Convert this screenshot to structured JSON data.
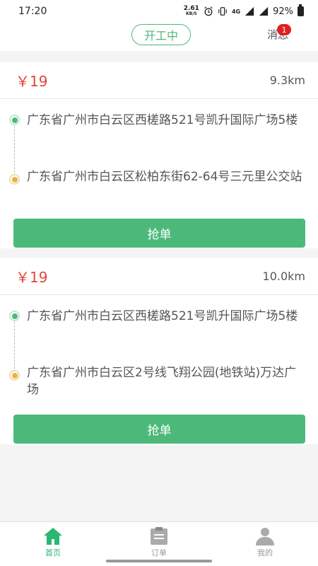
{
  "status_bar": {
    "time": "17:20",
    "net_speed": "2.61",
    "net_unit": "KB/S",
    "network": "4G",
    "battery": "92%"
  },
  "header": {
    "work_status": "开工中",
    "messages_label": "消息",
    "messages_badge": "1"
  },
  "orders": [
    {
      "price": "￥19",
      "distance": "9.3km",
      "start_address": "广东省广州市白云区西槎路521号凯升国际广场5楼",
      "end_address": "广东省广州市白云区松柏东街62-64号三元里公交站",
      "action_label": "抢单"
    },
    {
      "price": "￥19",
      "distance": "10.0km",
      "start_address": "广东省广州市白云区西槎路521号凯升国际广场5楼",
      "end_address": "广东省广州市白云区2号线飞翔公园(地铁站)万达广场",
      "action_label": "抢单"
    }
  ],
  "nav": {
    "items": [
      {
        "label": "首页",
        "icon": "home-icon",
        "active": true
      },
      {
        "label": "订单",
        "icon": "orders-icon",
        "active": false
      },
      {
        "label": "我的",
        "icon": "profile-icon",
        "active": false
      }
    ]
  },
  "colors": {
    "accent": "#4cb97a",
    "price": "#e0453a",
    "badge": "#e02020"
  }
}
